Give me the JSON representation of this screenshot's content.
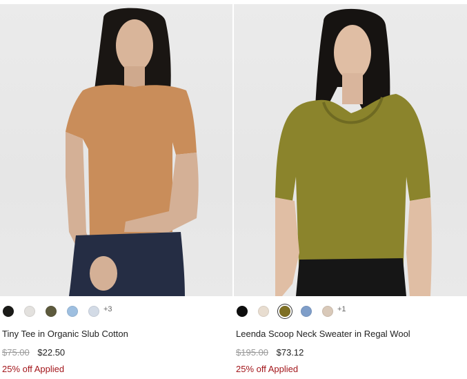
{
  "products": [
    {
      "name": "Tiny Tee in Organic Slub Cotton",
      "original_price": "$75.00",
      "sale_price": "$22.50",
      "promo": "25% off Applied",
      "swatches": [
        "#1b1b18",
        "#e3e1de",
        "#5d5a3d",
        "#9ebfe0",
        "#d3dbe6"
      ],
      "more_colors": "+3",
      "image_alt": "model wearing tan short-sleeve tee"
    },
    {
      "name": "Leenda Scoop Neck Sweater in Regal Wool",
      "original_price": "$195.00",
      "sale_price": "$73.12",
      "promo": "25% off Applied",
      "swatches": [
        "#0e0e0e",
        "#e8ddd0",
        "#7e6f24",
        "#7f9ec9",
        "#d9c9b9"
      ],
      "selected_swatch": 2,
      "more_colors": "+1",
      "image_alt": "model wearing olive scoop neck sweater"
    }
  ]
}
